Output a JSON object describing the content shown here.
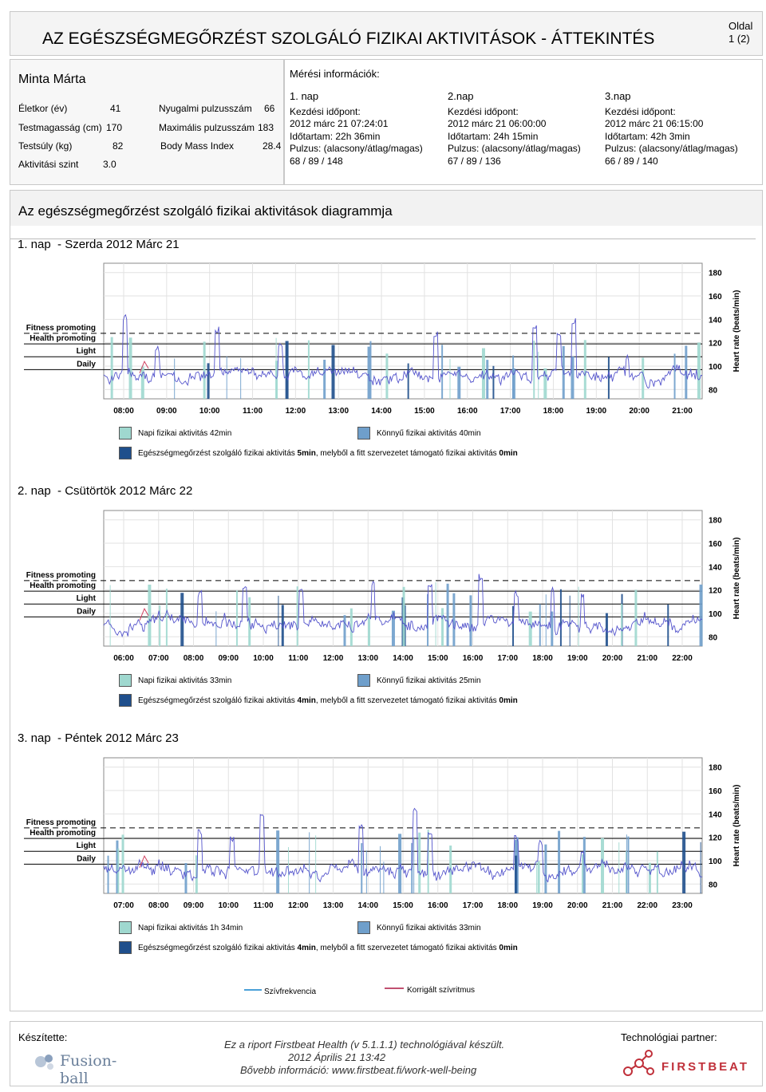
{
  "header": {
    "title": "AZ EGÉSZSÉGMEGŐRZÉST SZOLGÁLÓ FIZIKAI AKTIVITÁSOK - ÁTTEKINTÉS",
    "page_label": "Oldal",
    "page_number": "1 (2)"
  },
  "person": {
    "name": "Minta Márta",
    "rows": [
      {
        "label": "Életkor (év)",
        "value": "41",
        "label2": "Nyugalmi pulzusszám",
        "value2": "66"
      },
      {
        "label": "Testmagasság (cm)",
        "value": "170",
        "label2": "Maximális pulzusszám",
        "value2": "183"
      },
      {
        "label": "Testsúly (kg)",
        "value": "82",
        "label2": "Body Mass Index",
        "value2": "28.4"
      },
      {
        "label": "Aktivitási szint",
        "value": "3.0",
        "label2": "",
        "value2": ""
      }
    ]
  },
  "measurement": {
    "title": "Mérési információk:",
    "days": [
      {
        "name": "1. nap",
        "start_label": "Kezdési időpont:",
        "start": "2012 márc 21 07:24:01",
        "duration": "Időtartam: 22h 36min",
        "pulse_label": "Pulzus: (alacsony/átlag/magas)",
        "pulse": "68 / 89 / 148"
      },
      {
        "name": "2.nap",
        "start_label": "Kezdési időpont:",
        "start": "2012 márc 21 06:00:00",
        "duration": "Időtartam: 24h 15min",
        "pulse_label": "Pulzus: (alacsony/átlag/magas)",
        "pulse": "67 / 89 / 136"
      },
      {
        "name": "3.nap",
        "start_label": "Kezdési időpont:",
        "start": "2012 márc 21 06:15:00",
        "duration": "Időtartam: 42h 3min",
        "pulse_label": "Pulzus: (alacsony/átlag/magas)",
        "pulse": "66 / 89 / 140"
      }
    ]
  },
  "section": {
    "title": "Az egészségmegőrzést szolgáló fizikai aktivitások diagrammja"
  },
  "zone_labels": [
    "Fitness promoting",
    "Health promoting",
    "Light",
    "Daily"
  ],
  "y_axis_title": "Heart rate (beats/min)",
  "colors": {
    "daily_bar": "#9fd8cf",
    "light_bar": "#6f9fcb",
    "health_bar": "#1f4f8c",
    "hr_line": "#5555cc",
    "corrected_line": "#d04060"
  },
  "chart_data": [
    {
      "type": "line",
      "title": "1. nap  - Szerda 2012 Márc 21",
      "x_ticks": [
        "08:00",
        "09:00",
        "10:00",
        "11:00",
        "12:00",
        "13:00",
        "14:00",
        "15:00",
        "16:00",
        "17:00",
        "18:00",
        "19:00",
        "20:00",
        "21:00"
      ],
      "y_ticks": [
        180,
        160,
        140,
        120,
        100,
        80
      ],
      "ylim": [
        72,
        188
      ],
      "grid": true,
      "seed": 11,
      "spikes": [
        [
          0.035,
          145
        ],
        [
          0.09,
          118
        ],
        [
          0.19,
          134
        ],
        [
          0.295,
          120
        ],
        [
          0.555,
          131
        ],
        [
          0.72,
          138
        ],
        [
          0.76,
          128
        ],
        [
          0.785,
          142
        ],
        [
          0.875,
          110
        ]
      ],
      "legend": {
        "daily": "Napi fizikai aktivitás 42min",
        "light": "Könnyű fizikai aktivitás 40min",
        "health_pre": "Egészségmegőrzést szolgáló fizikai aktivitás ",
        "health_bold": "5min",
        "health_mid": ", melyből a fitt szervezetet támogató fizikai aktivitás ",
        "health_end": "0min"
      }
    },
    {
      "type": "line",
      "title": "2. nap  - Csütörtök 2012 Márc 22",
      "x_ticks": [
        "06:00",
        "07:00",
        "08:00",
        "09:00",
        "10:00",
        "11:00",
        "12:00",
        "13:00",
        "14:00",
        "15:00",
        "16:00",
        "17:00",
        "18:00",
        "19:00",
        "20:00",
        "21:00",
        "22:00"
      ],
      "y_ticks": [
        180,
        160,
        140,
        120,
        100,
        80
      ],
      "ylim": [
        72,
        188
      ],
      "grid": true,
      "seed": 23,
      "spikes": [
        [
          0.16,
          120
        ],
        [
          0.235,
          127
        ],
        [
          0.33,
          122
        ],
        [
          0.45,
          128
        ],
        [
          0.545,
          126
        ],
        [
          0.63,
          134
        ],
        [
          0.69,
          120
        ],
        [
          0.75,
          124
        ],
        [
          0.8,
          118
        ]
      ],
      "legend": {
        "daily": "Napi fizikai aktivitás 33min",
        "light": "Könnyű fizikai aktivitás 25min",
        "health_pre": "Egészségmegőrzést szolgáló fizikai aktivitás ",
        "health_bold": "4min",
        "health_mid": ", melyből a fitt szervezetet támogató fizikai aktivitás ",
        "health_end": "0min"
      }
    },
    {
      "type": "line",
      "title": "3. nap  - Péntek 2012 Márc 23",
      "x_ticks": [
        "07:00",
        "08:00",
        "09:00",
        "10:00",
        "11:00",
        "12:00",
        "13:00",
        "14:00",
        "15:00",
        "16:00",
        "17:00",
        "18:00",
        "19:00",
        "20:00",
        "21:00",
        "22:00",
        "23:00"
      ],
      "y_ticks": [
        180,
        160,
        140,
        120,
        100,
        80
      ],
      "ylim": [
        72,
        188
      ],
      "grid": true,
      "seed": 37,
      "spikes": [
        [
          0.16,
          128
        ],
        [
          0.215,
          122
        ],
        [
          0.265,
          140
        ],
        [
          0.43,
          132
        ],
        [
          0.52,
          148
        ],
        [
          0.545,
          126
        ],
        [
          0.69,
          122
        ],
        [
          0.73,
          118
        ],
        [
          0.8,
          112
        ]
      ],
      "legend": {
        "daily": "Napi fizikai aktivitás 1h 34min",
        "light": "Könnyű fizikai aktivitás 33min",
        "health_pre": "Egészségmegőrzést szolgáló fizikai aktivitás ",
        "health_bold": "4min",
        "health_mid": ", melyből a fitt szervezetet támogató fizikai aktivitás ",
        "health_end": "0min"
      }
    }
  ],
  "bottom_legend": {
    "hr": "Szívfrekvencia",
    "corrected": "Korrigált szívritmus"
  },
  "footer": {
    "made_by": "Készítette:",
    "left_logo": "Fusion-ball",
    "line1": "Ez a riport Firstbeat Health (v 5.1.1.1) technológiával készült.",
    "line2": "2012 Április 21 13:42",
    "line3": "Bővebb információ: www.firstbeat.fi/work-well-being",
    "partner": "Technológiai partner:",
    "right_logo": "FIRSTBEAT"
  }
}
